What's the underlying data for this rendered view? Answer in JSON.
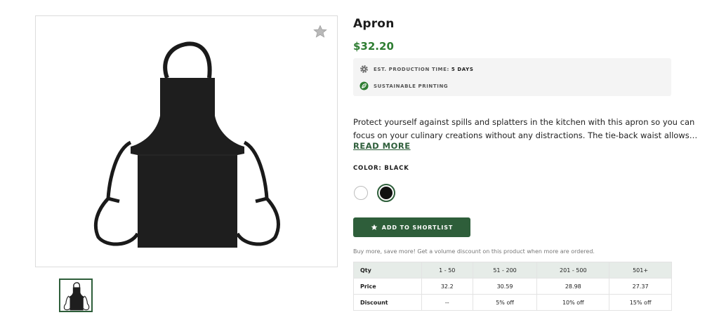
{
  "product": {
    "title": "Apron",
    "price": "$32.20",
    "favorite_icon": "star-icon"
  },
  "info": {
    "production_label": "EST. PRODUCTION TIME:",
    "production_value": "5 DAYS",
    "production_icon": "gear-icon",
    "sustainable_label": "SUSTAINABLE PRINTING",
    "sustainable_icon": "leaf-icon"
  },
  "description": {
    "line1": "Protect yourself against spills and splatters in the kitchen with this apron so you can",
    "line2": "focus on your culinary creations without any distractions. The tie-back waist allows…",
    "read_more": "READ MORE"
  },
  "color": {
    "label": "COLOR: BLACK",
    "options": [
      {
        "name": "White",
        "hex": "#ffffff"
      },
      {
        "name": "Black",
        "hex": "#111111",
        "selected": true
      }
    ]
  },
  "actions": {
    "shortlist_label": "ADD TO SHORTLIST"
  },
  "volume": {
    "note": "Buy more, save more! Get a volume discount on this product when more are ordered.",
    "headers": [
      "Qty",
      "1 - 50",
      "51 - 200",
      "201 - 500",
      "501+"
    ],
    "price_row": [
      "Price",
      "32.2",
      "30.59",
      "28.98",
      "27.37"
    ],
    "discount_row": [
      "Discount",
      "--",
      "5% off",
      "10% off",
      "15% off"
    ]
  },
  "colors": {
    "accent": "#2e5e3a",
    "price": "#2e7d32",
    "table_header_bg": "#e6ece8"
  }
}
